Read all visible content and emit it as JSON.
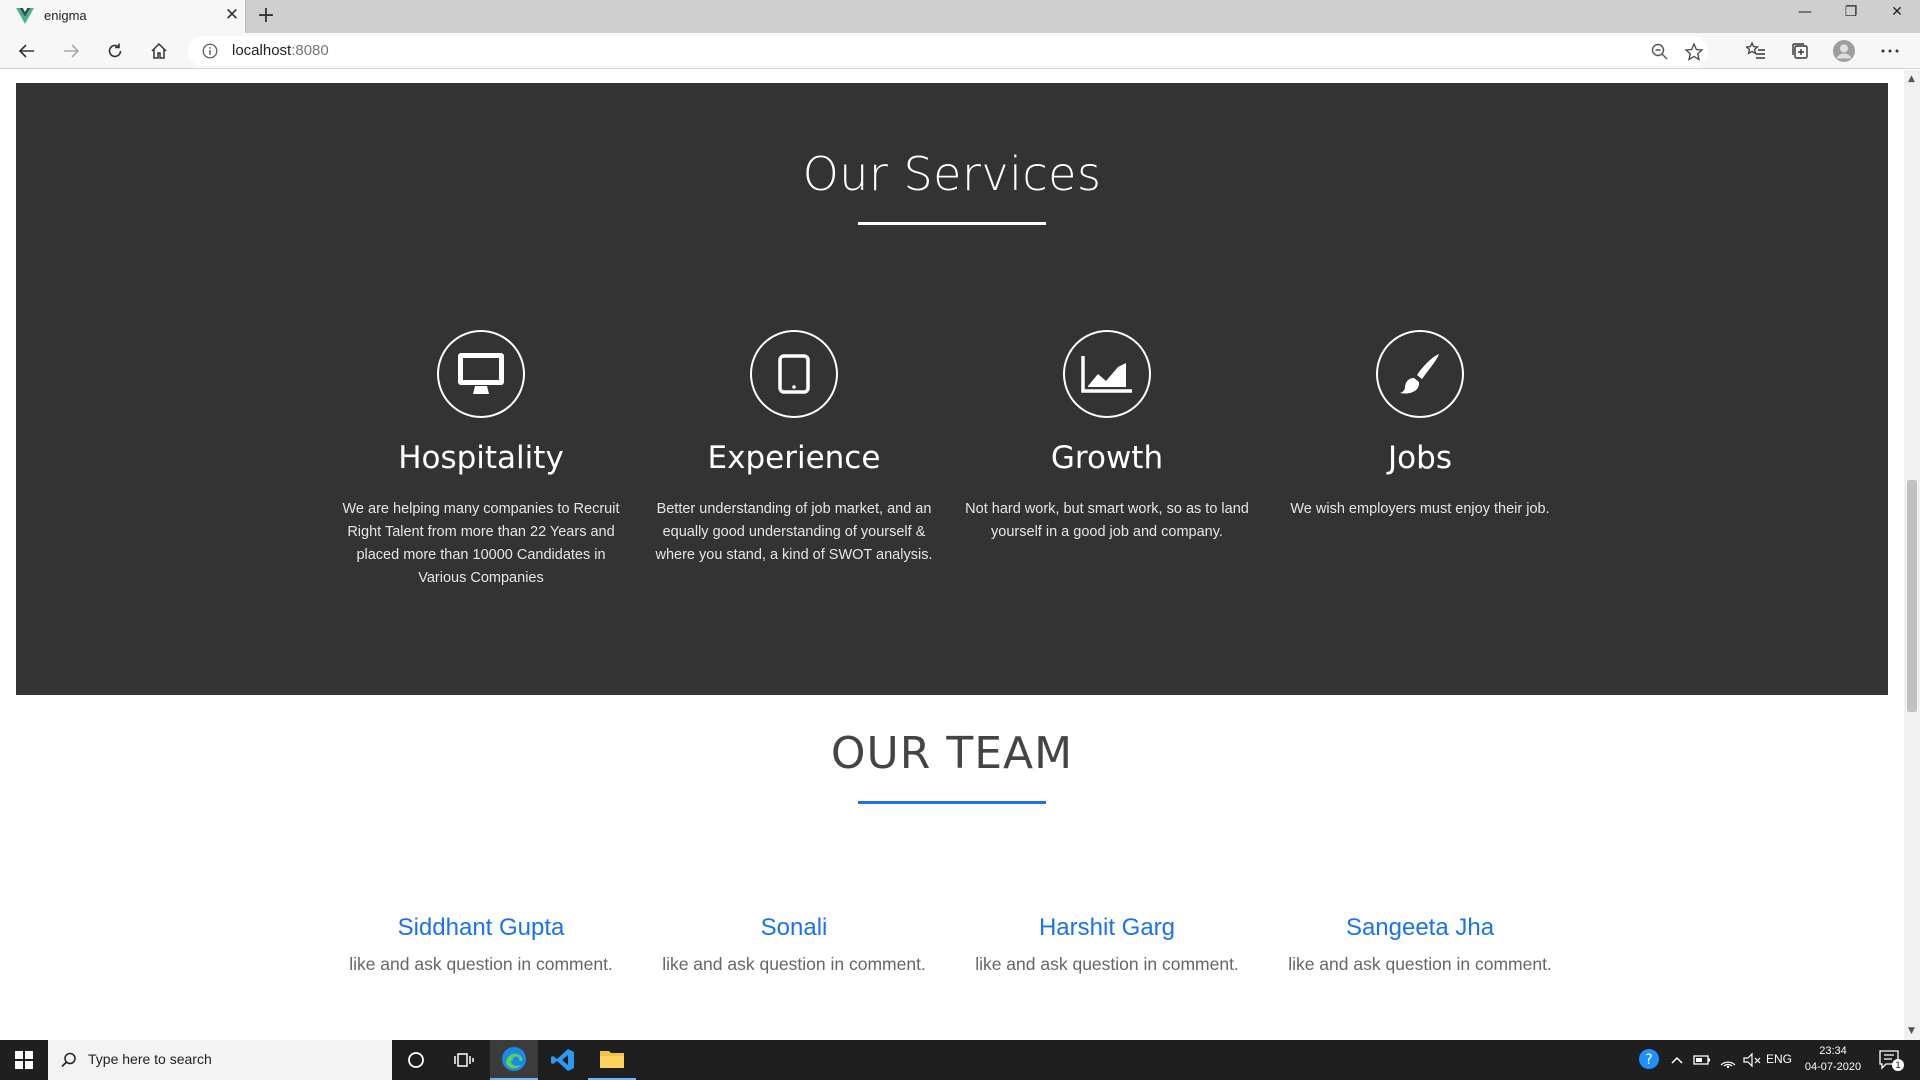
{
  "browser": {
    "tab_title": "enigma",
    "tab_close": "✕",
    "new_tab": "+",
    "url_host": "localhost",
    "url_port": ":8080",
    "window": {
      "minimize": "—",
      "restore": "❐",
      "close": "✕"
    }
  },
  "services": {
    "heading": "Our Services",
    "items": [
      {
        "icon": "desktop-icon",
        "title": "Hospitality",
        "description": "We are helping many companies to Recruit Right Talent from more than 22 Years and placed more than 10000 Candidates in Various Companies"
      },
      {
        "icon": "tablet-icon",
        "title": "Experience",
        "description": "Better understanding of job market, and an equally good understanding of yourself & where you stand, a kind of SWOT analysis."
      },
      {
        "icon": "area-chart-icon",
        "title": "Growth",
        "description": "Not hard work, but smart work, so as to land yourself in a good job and company."
      },
      {
        "icon": "paint-brush-icon",
        "title": "Jobs",
        "description": "We wish employers must enjoy their job."
      }
    ]
  },
  "team": {
    "heading": "OUR TEAM",
    "members": [
      {
        "name": "Siddhant Gupta",
        "note": "like and ask question in comment."
      },
      {
        "name": "Sonali",
        "note": "like and ask question in comment."
      },
      {
        "name": "Harshit Garg",
        "note": "like and ask question in comment."
      },
      {
        "name": "Sangeeta Jha",
        "note": "like and ask question in comment."
      }
    ]
  },
  "taskbar": {
    "search_placeholder": "Type here to search",
    "language": "ENG",
    "time": "23:34",
    "date": "04-07-2020",
    "notification_count": "1"
  },
  "colors": {
    "services_bg": "#333333",
    "accent": "#1a73e8",
    "taskbar_bg": "#1f1f1f"
  }
}
